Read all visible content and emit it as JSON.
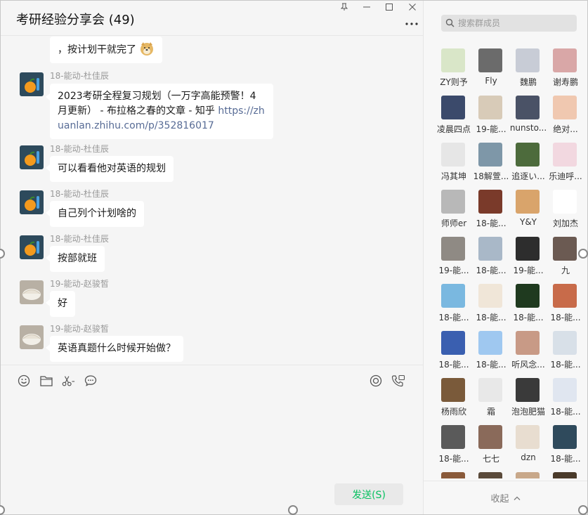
{
  "chat": {
    "title": "考研经验分享会 (49)",
    "messages": [
      {
        "sender": "",
        "text": "，按计划干就完了",
        "emoji": "doge-emoji"
      },
      {
        "sender": "18-能动-杜佳辰",
        "text": "2023考研全程复习规划（一万字高能预警！4月更新） - 布拉格之春的文章 - 知乎 ",
        "link": "https://zhuanlan.zhihu.com/p/352816017"
      },
      {
        "sender": "18-能动-杜佳辰",
        "text": "可以看看他对英语的规划"
      },
      {
        "sender": "18-能动-杜佳辰",
        "text": "自己列个计划啥的"
      },
      {
        "sender": "18-能动-杜佳辰",
        "text": "按部就班"
      },
      {
        "sender": "19-能动-赵骏皙",
        "text": "好"
      },
      {
        "sender": "19-能动-赵骏皙",
        "text": "英语真题什么时候开始做？"
      }
    ],
    "toolbar": {
      "left_icons": [
        "emoji-icon",
        "folder-icon",
        "scissors-icon",
        "chat-bubble-icon"
      ],
      "right_icons": [
        "live-icon",
        "voice-call-icon"
      ]
    },
    "send_label": "发送(S)"
  },
  "members": {
    "search_placeholder": "搜索群成员",
    "list": [
      {
        "name": "ZY则予",
        "color": "#d9e6c8"
      },
      {
        "name": "Fly",
        "color": "#6b6b6b"
      },
      {
        "name": "魏鹏",
        "color": "#c8ccd6"
      },
      {
        "name": "谢寿鹏",
        "color": "#d9a7a7"
      },
      {
        "name": "凌晨四点",
        "color": "#3b4a6b"
      },
      {
        "name": "19-能...",
        "color": "#d8cbb8"
      },
      {
        "name": "nunsto...",
        "color": "#4a5266"
      },
      {
        "name": "绝对...",
        "color": "#f0c8b0"
      },
      {
        "name": "冯其坤",
        "color": "#e6e6e6"
      },
      {
        "name": "18解萱...",
        "color": "#7e97a8"
      },
      {
        "name": "追逐い...",
        "color": "#4d6b3c"
      },
      {
        "name": "乐迪呼...",
        "color": "#f2d8e0"
      },
      {
        "name": "师师er",
        "color": "#b8b8b8"
      },
      {
        "name": "18-能...",
        "color": "#7a3a2a"
      },
      {
        "name": "Y&Y",
        "color": "#d9a46b"
      },
      {
        "name": "刘加杰",
        "color": "#ffffff"
      },
      {
        "name": "19-能...",
        "color": "#8f8a84"
      },
      {
        "name": "18-能...",
        "color": "#a9b8c8"
      },
      {
        "name": "19-能...",
        "color": "#2d2d2d"
      },
      {
        "name": "九",
        "color": "#6b5a52"
      },
      {
        "name": "18-能...",
        "color": "#7ab8e0"
      },
      {
        "name": "18-能...",
        "color": "#f0e6d8"
      },
      {
        "name": "18-能...",
        "color": "#1f3a1f"
      },
      {
        "name": "18-能...",
        "color": "#c86b4a"
      },
      {
        "name": "18-能...",
        "color": "#3a5fb0"
      },
      {
        "name": "18-能...",
        "color": "#9fc8f0"
      },
      {
        "name": "听风念...",
        "color": "#c89a86"
      },
      {
        "name": "18-能...",
        "color": "#d8e0e8"
      },
      {
        "name": "杨雨欣",
        "color": "#7a5a3a"
      },
      {
        "name": "霜",
        "color": "#e8e8e8"
      },
      {
        "name": "泡泡肥猫",
        "color": "#3a3a3a"
      },
      {
        "name": "18-能...",
        "color": "#e0e6f0"
      },
      {
        "name": "18-能...",
        "color": "#5a5a5a"
      },
      {
        "name": "七七",
        "color": "#8a6a5a"
      },
      {
        "name": "dzn",
        "color": "#e8ddd0"
      },
      {
        "name": "18-能...",
        "color": "#2f4a5c"
      },
      {
        "name": "",
        "color": "#8a5a3a"
      },
      {
        "name": "",
        "color": "#5a4a3a"
      },
      {
        "name": "",
        "color": "#c8a88a"
      },
      {
        "name": "",
        "color": "#4a3a2a"
      }
    ]
  },
  "footer": {
    "collapse_label": "收起"
  }
}
